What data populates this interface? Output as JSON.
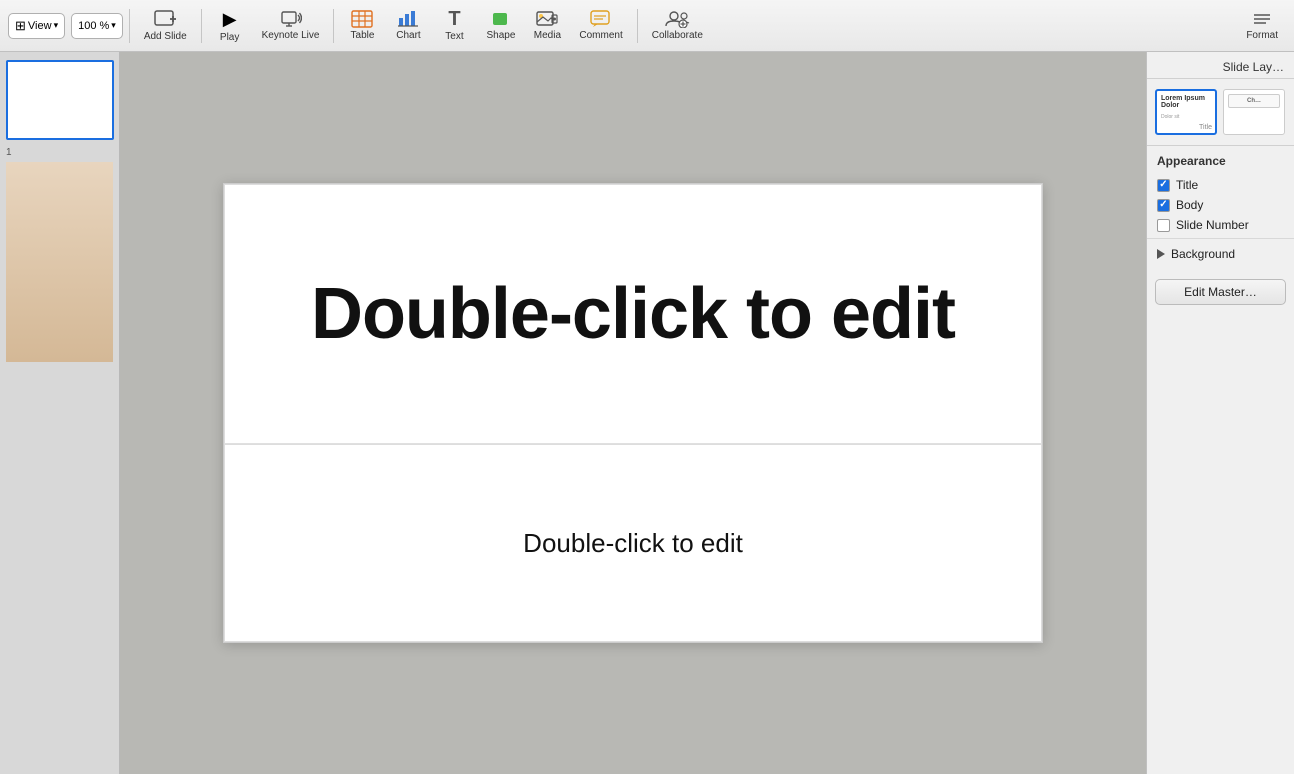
{
  "toolbar": {
    "view_label": "View",
    "zoom_value": "100 %",
    "add_slide_label": "Add Slide",
    "play_label": "Play",
    "keynote_live_label": "Keynote Live",
    "table_label": "Table",
    "chart_label": "Chart",
    "text_label": "Text",
    "shape_label": "Shape",
    "media_label": "Media",
    "comment_label": "Comment",
    "collaborate_label": "Collaborate",
    "format_label": "Format"
  },
  "slide": {
    "title_placeholder": "Double-click to edit",
    "body_placeholder": "Double-click to edit",
    "number": "1"
  },
  "right_panel": {
    "header": "Slide Lay…",
    "layout_title": "Title",
    "layout_change": "Ch…",
    "appearance_label": "Appearance",
    "title_checkbox": "Title",
    "title_checked": true,
    "body_checkbox": "Body",
    "body_checked": true,
    "slide_number_checkbox": "Slide Number",
    "slide_number_checked": false,
    "background_label": "Background",
    "edit_master_label": "Edit Master…"
  },
  "icons": {
    "view": "⊞",
    "zoom_arrow": "▾",
    "add": "+",
    "play": "▶",
    "keynote": "📡",
    "table": "⊞",
    "chart": "📊",
    "text": "T",
    "shape": "■",
    "media": "🖼",
    "comment": "💬",
    "collaborate": "👤",
    "format": "≡",
    "checkmark": "✓"
  }
}
